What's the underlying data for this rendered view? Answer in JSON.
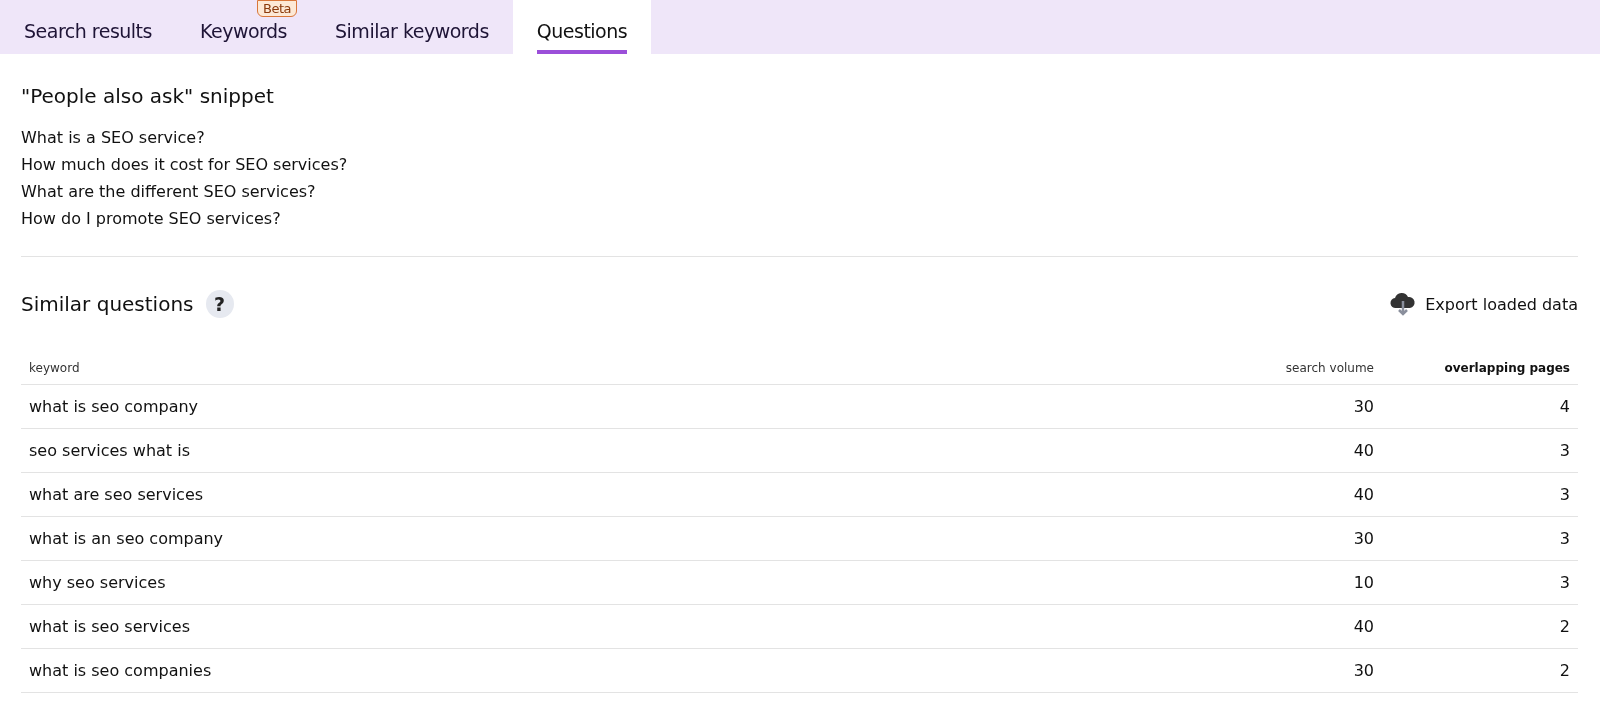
{
  "tabs": [
    {
      "label": "Search results",
      "selected": false
    },
    {
      "label": "Keywords",
      "selected": false,
      "badge": "Beta"
    },
    {
      "label": "Similar keywords",
      "selected": false
    },
    {
      "label": "Questions",
      "selected": true
    }
  ],
  "snippet": {
    "title": "\"People also ask\" snippet",
    "questions": [
      "What is a SEO service?",
      "How much does it cost for SEO services?",
      "What are the different SEO services?",
      "How do I promote SEO services?"
    ]
  },
  "similar": {
    "title": "Similar questions",
    "help": "?",
    "export": "Export loaded data"
  },
  "table": {
    "columns": [
      {
        "label": "keyword",
        "sorted": false
      },
      {
        "label": "search volume",
        "sorted": false
      },
      {
        "label": "overlapping pages",
        "sorted": true
      }
    ],
    "rows": [
      [
        "what is seo company",
        "30",
        "4"
      ],
      [
        "seo services what is",
        "40",
        "3"
      ],
      [
        "what are seo services",
        "40",
        "3"
      ],
      [
        "what is an seo company",
        "30",
        "3"
      ],
      [
        "why seo services",
        "10",
        "3"
      ],
      [
        "what is seo services",
        "40",
        "2"
      ],
      [
        "what is seo companies",
        "30",
        "2"
      ]
    ]
  }
}
